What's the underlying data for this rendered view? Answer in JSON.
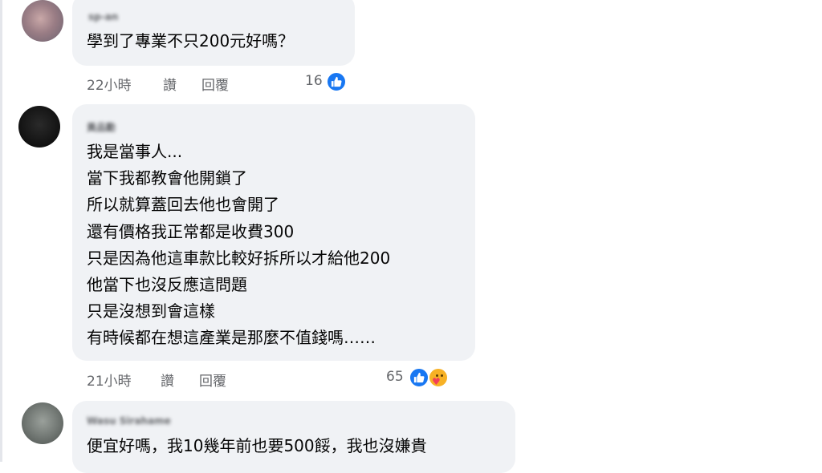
{
  "comments": [
    {
      "author": "sp-an",
      "lines": [
        "學到了專業不只200元好嗎？"
      ],
      "time": "22小時",
      "like_label": "讚",
      "reply_label": "回覆",
      "reaction_count": "16",
      "reactions": [
        "like-icon"
      ]
    },
    {
      "author": "黃品勳",
      "lines": [
        "我是當事人...",
        "當下我都教會他開鎖了",
        "所以就算蓋回去他也會開了",
        "還有價格我正常都是收費300",
        "只是因為他這車款比較好拆所以才給他200",
        "他當下也沒反應這問題",
        "只是沒想到會這樣",
        "有時候都在想這產業是那麼不值錢嗎……"
      ],
      "time": "21小時",
      "like_label": "讚",
      "reply_label": "回覆",
      "reaction_count": "65",
      "reactions": [
        "like-icon",
        "care-icon"
      ]
    },
    {
      "author": "Wasu Sirahame",
      "lines": [
        "便宜好嗎，我10幾年前也要500餒，我也沒嫌貴"
      ]
    }
  ],
  "colors": {
    "bubble": "#f0f2f5",
    "meta_text": "#65676b",
    "like_blue": "#1877f2",
    "care_yellow": "#f7b125"
  }
}
